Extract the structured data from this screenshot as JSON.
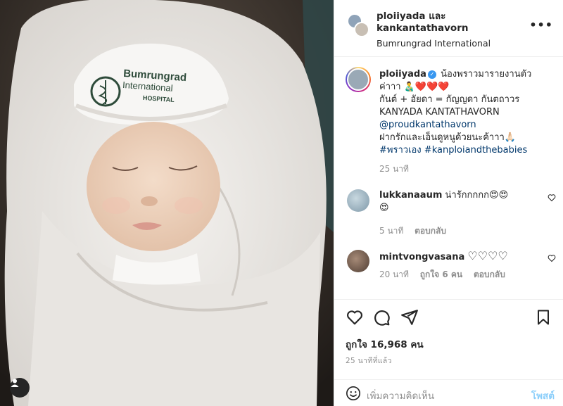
{
  "header": {
    "title_line1": "ploiiyada และ",
    "title_line2": "kankantathavorn",
    "location": "Bumrungrad International",
    "more_label": "•••"
  },
  "photo": {
    "hat_text_line1": "Bumrungrad",
    "hat_text_line2": "International",
    "hat_text_line3": "HOSPITAL"
  },
  "caption": {
    "username": "ploiiyada",
    "verified_mark": "✓",
    "line1": "น้องพราวมารายงานตัว",
    "line2": "ค่าาา 👨‍🍼❤️❤️❤️",
    "line3": "กันต์ + อัยดา = กัญญดา กันตถาวร",
    "line4": "KANYADA KANTATHAVORN",
    "mention": "@proudkantathavorn",
    "line5": "ฝากรักและเอ็นดูหนูด้วยนะค้าาา🙏🏻",
    "line6": "",
    "hashtag1": "#พราวเอง",
    "hashtag2": "#kanploiandthebabies",
    "time": "25 นาที"
  },
  "comments": [
    {
      "username": "lukkanaaum",
      "text": "น่ารักกกกก😍😍",
      "text2": "😍",
      "time": "5 นาที",
      "reply": "ตอบกลับ"
    },
    {
      "username": "mintvongvasana",
      "text": "♡♡♡♡",
      "time": "20 นาที",
      "likes": "ถูกใจ 6 คน",
      "reply": "ตอบกลับ"
    }
  ],
  "actions": {
    "likes": "ถูกใจ 16,968 คน",
    "posted_ago": "25 นาทีที่แล้ว"
  },
  "add_comment": {
    "placeholder": "เพิ่มความคิดเห็น",
    "post_label": "โพสต์"
  },
  "colors": {
    "link": "#00376b",
    "accent": "#0095f6",
    "muted": "#8e8e8e",
    "verified": "#3897f0"
  }
}
